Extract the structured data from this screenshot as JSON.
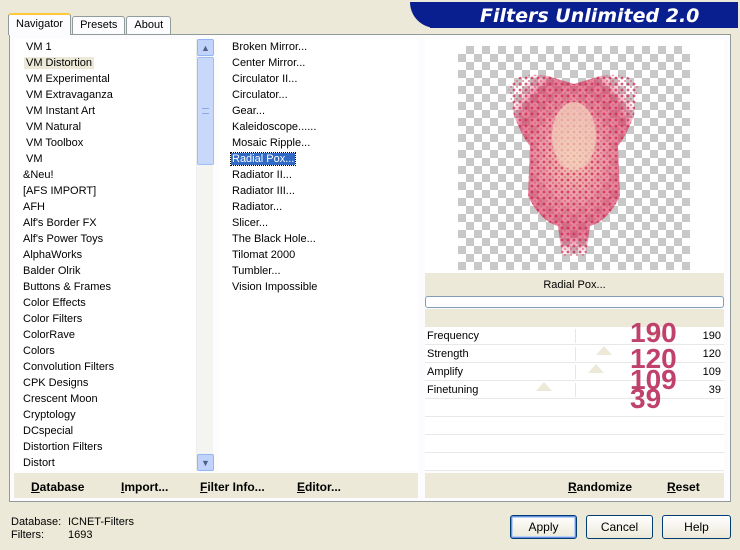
{
  "tabs": [
    {
      "label": "Navigator",
      "active": true
    },
    {
      "label": "Presets",
      "active": false
    },
    {
      "label": "About",
      "active": false
    }
  ],
  "app_title": "Filters Unlimited 2.0",
  "categories": [
    {
      "label": "VM 1"
    },
    {
      "label": "VM Distortion",
      "selected": true
    },
    {
      "label": "VM Experimental"
    },
    {
      "label": "VM Extravaganza"
    },
    {
      "label": "VM Instant Art"
    },
    {
      "label": "VM Natural"
    },
    {
      "label": "VM Toolbox"
    },
    {
      "label": "VM"
    },
    {
      "label": "&Neu!"
    },
    {
      "label": "[AFS IMPORT]"
    },
    {
      "label": "AFH"
    },
    {
      "label": "Alf's Border FX"
    },
    {
      "label": "Alf's Power Toys"
    },
    {
      "label": "AlphaWorks"
    },
    {
      "label": "Balder Olrik"
    },
    {
      "label": "Buttons & Frames"
    },
    {
      "label": "Color Effects"
    },
    {
      "label": "Color Filters"
    },
    {
      "label": "ColorRave"
    },
    {
      "label": "Colors"
    },
    {
      "label": "Convolution Filters"
    },
    {
      "label": "CPK Designs"
    },
    {
      "label": "Crescent Moon"
    },
    {
      "label": "Cryptology"
    },
    {
      "label": "DCspecial"
    },
    {
      "label": "Distortion Filters"
    },
    {
      "label": "Distort"
    }
  ],
  "filters": [
    {
      "label": "Broken Mirror..."
    },
    {
      "label": "Center Mirror..."
    },
    {
      "label": "Circulator II..."
    },
    {
      "label": "Circulator..."
    },
    {
      "label": "Gear..."
    },
    {
      "label": "Kaleidoscope......"
    },
    {
      "label": "Mosaic Ripple..."
    },
    {
      "label": "Radial Pox...",
      "selected": true
    },
    {
      "label": "Radiator II..."
    },
    {
      "label": "Radiator III..."
    },
    {
      "label": "Radiator..."
    },
    {
      "label": "Slicer..."
    },
    {
      "label": "The Black Hole..."
    },
    {
      "label": "Tilomat 2000"
    },
    {
      "label": "Tumbler..."
    },
    {
      "label": "Vision Impossible"
    }
  ],
  "links": {
    "database": "Database",
    "import": "Import...",
    "filter_info": "Filter Info...",
    "editor": "Editor..."
  },
  "selected_filter_name": "Radial Pox...",
  "params": [
    {
      "label": "Frequency",
      "value": "190",
      "fraction": 0.745
    },
    {
      "label": "Strength",
      "value": "120",
      "fraction": 0.47
    },
    {
      "label": "Amplify",
      "value": "109",
      "fraction": 0.427
    },
    {
      "label": "Finetuning",
      "value": "39",
      "fraction": 0.153
    }
  ],
  "overlay_numbers": [
    "190",
    "120",
    "109",
    "39"
  ],
  "actions": {
    "randomize": "Randomize",
    "reset": "Reset"
  },
  "footer": {
    "database_label": "Database:",
    "database_value": "ICNET-Filters",
    "filters_label": "Filters:",
    "filters_value": "1693"
  },
  "buttons": {
    "apply": "Apply",
    "cancel": "Cancel",
    "help": "Help"
  },
  "icons": {
    "scroll_up": "triangle-up-icon",
    "scroll_down": "triangle-down-icon"
  }
}
